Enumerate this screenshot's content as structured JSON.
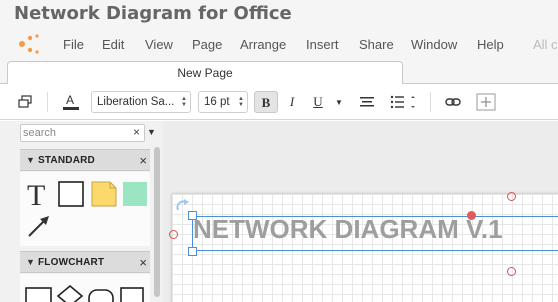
{
  "app": {
    "title": "Network Diagram for Office"
  },
  "menu": {
    "items": [
      "File",
      "Edit",
      "View",
      "Page",
      "Arrange",
      "Insert",
      "Share",
      "Window",
      "Help"
    ],
    "faded_item": "All c"
  },
  "tabs": [
    {
      "label": "New Page"
    }
  ],
  "toolbar": {
    "font_family": "Liberation Sa...",
    "font_size": "16 pt",
    "bold_label": "B",
    "italic_label": "I",
    "underline_label": "U"
  },
  "sidebar": {
    "search": {
      "placeholder": "search",
      "clear_label": "×"
    },
    "sections": [
      {
        "title": "STANDARD",
        "close_label": "×",
        "shapes": [
          "text",
          "rectangle",
          "note",
          "colored-rectangle",
          "arrow-line"
        ]
      },
      {
        "title": "FLOWCHART",
        "close_label": "×",
        "shapes": [
          "process",
          "decision",
          "terminator",
          "document"
        ]
      }
    ]
  },
  "canvas": {
    "diagram_text": "NETWORK DIAGRAM V.1"
  },
  "colors": {
    "accent": "#f39c4a",
    "note_yellow": "#fcd96b",
    "shape_green": "#9be5c3",
    "selection_blue": "#4a90d9",
    "handle_red": "#e05a5a"
  },
  "icons": [
    "app-logo-icon",
    "format-panel-icon",
    "text-color-icon",
    "align-icon",
    "list-icon",
    "link-icon",
    "add-icon",
    "rotate-icon"
  ]
}
